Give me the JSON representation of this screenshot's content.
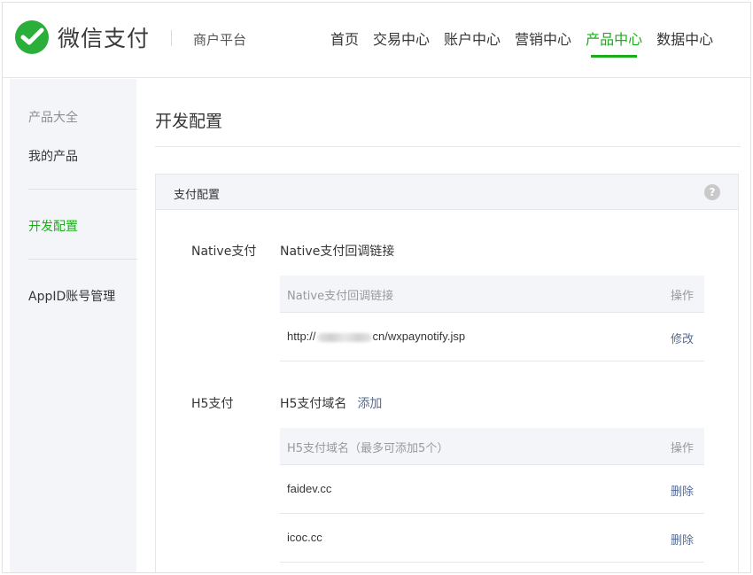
{
  "header": {
    "brand": "微信支付",
    "sub_platform": "商户平台",
    "nav": [
      {
        "label": "首页"
      },
      {
        "label": "交易中心"
      },
      {
        "label": "账户中心"
      },
      {
        "label": "营销中心"
      },
      {
        "label": "产品中心",
        "active": true
      },
      {
        "label": "数据中心"
      }
    ]
  },
  "sidebar": {
    "items": [
      {
        "label": "产品大全"
      },
      {
        "label": "我的产品"
      },
      {
        "label": "开发配置",
        "active": true
      },
      {
        "label": "AppID账号管理"
      }
    ]
  },
  "main": {
    "page_title": "开发配置",
    "panel": {
      "title": "支付配置",
      "help_icon": "question-circle-icon"
    },
    "native": {
      "label": "Native支付",
      "name": "Native支付回调链接",
      "table": {
        "col1": "Native支付回调链接",
        "col2": "操作",
        "rows": [
          {
            "url_prefix": "http://",
            "url_suffix": "cn/wxpaynotify.jsp",
            "action": "修改"
          }
        ]
      }
    },
    "h5": {
      "label": "H5支付",
      "name": "H5支付域名",
      "add_link": "添加",
      "table": {
        "col1": "H5支付域名（最多可添加5个）",
        "col2": "操作",
        "rows": [
          {
            "domain": "faidev.cc",
            "action": "删除"
          },
          {
            "domain": "icoc.cc",
            "action": "删除"
          }
        ]
      }
    }
  },
  "colors": {
    "brand_green": "#1aad19",
    "logo_green": "#2bae3a",
    "link_blue": "#576b95",
    "sidebar_bg": "#f4f5f9"
  }
}
